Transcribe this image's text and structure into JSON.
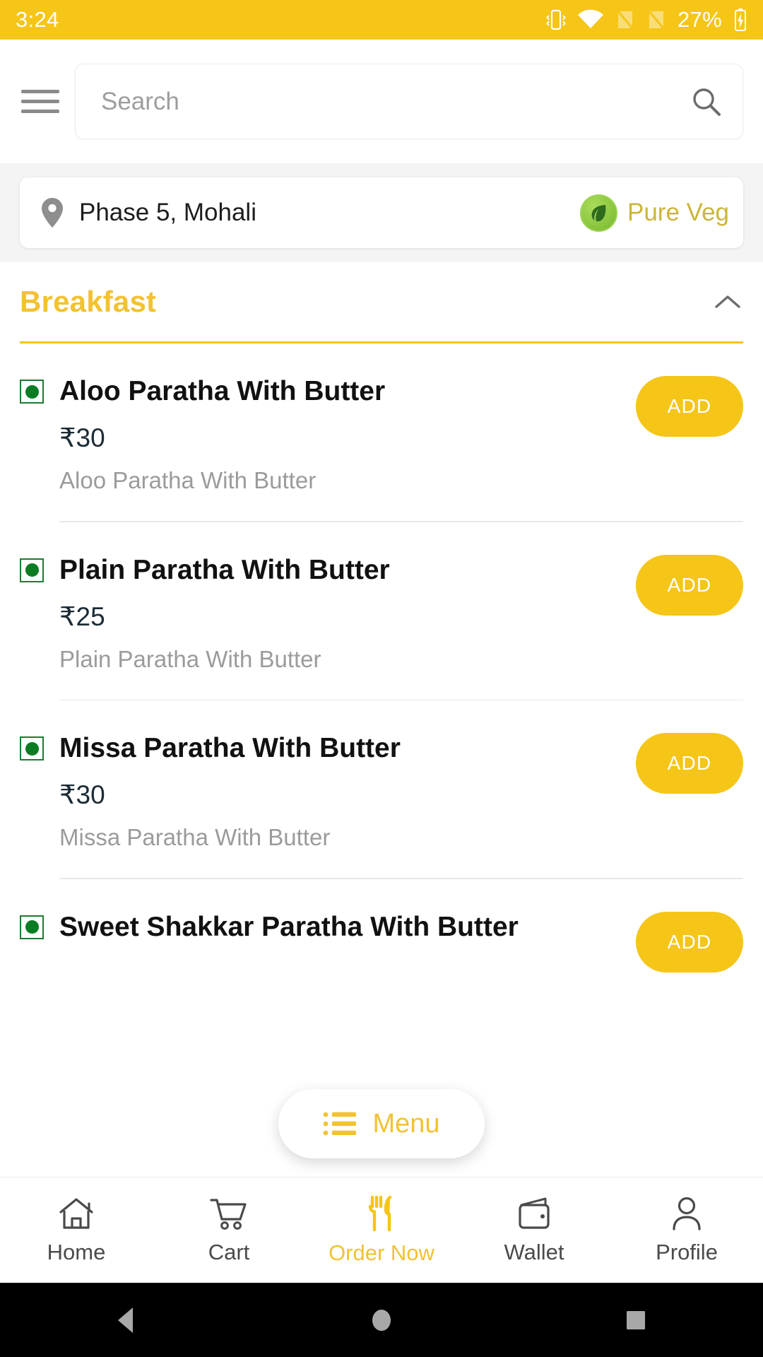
{
  "status_bar": {
    "time": "3:24",
    "battery_percent": "27%",
    "icons": [
      "vibrate-icon",
      "wifi-icon",
      "signal-off-icon",
      "signal-off-icon",
      "battery-charging-icon"
    ]
  },
  "header": {
    "menu_icon": "hamburger-icon",
    "search": {
      "placeholder": "Search",
      "value": "",
      "icon": "search-icon"
    }
  },
  "location": {
    "pin_icon": "location-pin-icon",
    "address": "Phase 5, Mohali",
    "badge_label": "Pure Veg",
    "badge_icon": "leaf-icon"
  },
  "section": {
    "title": "Breakfast",
    "collapse_icon": "chevron-up-icon",
    "expanded": true
  },
  "menu_items": [
    {
      "veg": true,
      "name": "Aloo Paratha With Butter",
      "price": "₹30",
      "description": "Aloo Paratha With Butter",
      "add_label": "ADD"
    },
    {
      "veg": true,
      "name": "Plain Paratha With Butter",
      "price": "₹25",
      "description": "Plain Paratha With Butter",
      "add_label": "ADD"
    },
    {
      "veg": true,
      "name": "Missa Paratha With Butter",
      "price": "₹30",
      "description": "Missa Paratha With Butter",
      "add_label": "ADD"
    },
    {
      "veg": true,
      "name": "Sweet Shakkar Paratha With Butter",
      "price": "",
      "description": "",
      "add_label": "ADD"
    }
  ],
  "menu_fab": {
    "label": "Menu",
    "icon": "list-icon"
  },
  "bottom_nav": [
    {
      "label": "Home",
      "icon": "home-icon",
      "active": false
    },
    {
      "label": "Cart",
      "icon": "cart-icon",
      "active": false
    },
    {
      "label": "Order Now",
      "icon": "cutlery-icon",
      "active": true
    },
    {
      "label": "Wallet",
      "icon": "wallet-icon",
      "active": false
    },
    {
      "label": "Profile",
      "icon": "person-icon",
      "active": false
    }
  ],
  "android_nav": [
    {
      "name": "back-button",
      "icon": "triangle-left-icon"
    },
    {
      "name": "home-button",
      "icon": "circle-icon"
    },
    {
      "name": "recents-button",
      "icon": "square-icon"
    }
  ],
  "colors": {
    "brand_yellow": "#F5C518",
    "title_yellow": "#F2C230",
    "veg_green": "#0a7d22",
    "badge_green": "#8cc63f",
    "text_dark": "#111111",
    "text_muted": "#9b9b9b"
  }
}
